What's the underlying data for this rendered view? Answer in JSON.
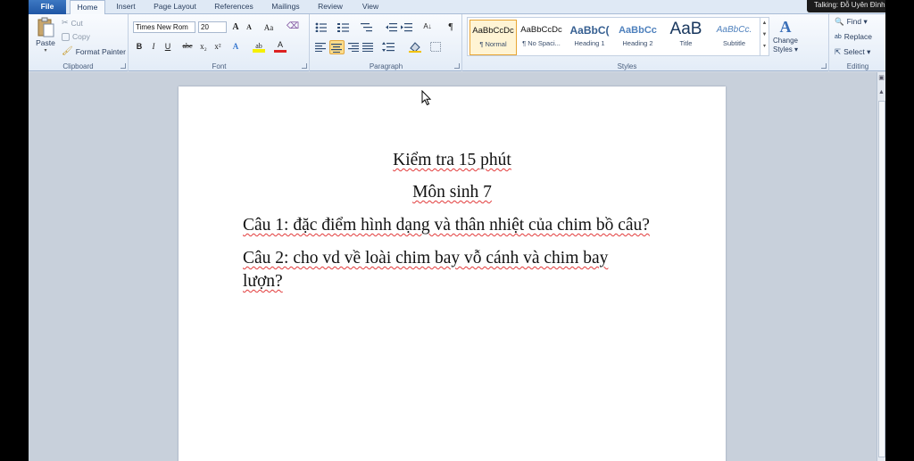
{
  "tabs": [
    "File",
    "Home",
    "Insert",
    "Page Layout",
    "References",
    "Mailings",
    "Review",
    "View"
  ],
  "active_tab": "Home",
  "talking_indicator": "Talking: Đỗ Uyên Đình T",
  "clipboard": {
    "paste": "Paste",
    "cut": "Cut",
    "copy": "Copy",
    "format_painter": "Format Painter",
    "label": "Clipboard"
  },
  "font": {
    "name": "Times New Rom",
    "size": "20",
    "grow": "A",
    "shrink": "A",
    "case": "Aa",
    "bold": "B",
    "italic": "I",
    "underline": "U",
    "strike": "abc",
    "subscript": "x₂",
    "superscript": "x²",
    "effects": "A",
    "highlight": "ab",
    "color": "A",
    "label": "Font"
  },
  "paragraph": {
    "label": "Paragraph",
    "pilcrow": "¶",
    "sort": "A↓"
  },
  "styles": {
    "label": "Styles",
    "items": [
      {
        "sample": "AaBbCcDc",
        "name": "¶ Normal",
        "selected": true
      },
      {
        "sample": "AaBbCcDc",
        "name": "¶ No Spaci...",
        "selected": false
      },
      {
        "sample": "AaBbC(",
        "name": "Heading 1",
        "selected": false
      },
      {
        "sample": "AaBbCc",
        "name": "Heading 2",
        "selected": false
      },
      {
        "sample": "AaB",
        "name": "Title",
        "selected": false
      },
      {
        "sample": "AaBbCc.",
        "name": "Subtitle",
        "selected": false
      }
    ],
    "change_styles_line1": "Change",
    "change_styles_line2": "Styles ▾"
  },
  "editing": {
    "find": "Find ▾",
    "replace": "Replace",
    "select": "Select ▾",
    "label": "Editing"
  },
  "document": {
    "line1": "Kiểm tra 15 phút",
    "line2": "Môn sinh 7",
    "line3": "Câu 1: đặc điểm hình dạng và thân nhiệt của chim bồ câu?",
    "line4": "Câu 2: cho vd về loài chim bay vỗ cánh và chim bay",
    "line5": "lượn?"
  },
  "colors": {
    "file_tab": "#2a67b4",
    "ribbon_bg": "#e3ecf7",
    "workspace": "#c8d0db",
    "spell_squiggle": "#e23b3b",
    "selected_style": "#fff4d4"
  },
  "icons": [
    "paste-icon",
    "cut-icon",
    "copy-icon",
    "format-painter-icon",
    "find-icon",
    "replace-icon",
    "select-icon",
    "change-styles-icon",
    "mouse-pointer-icon"
  ]
}
